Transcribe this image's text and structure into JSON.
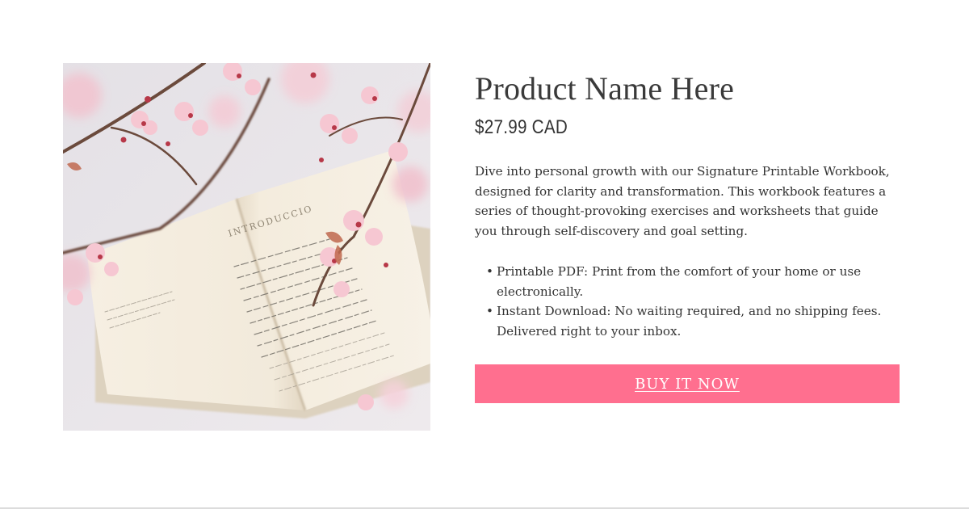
{
  "product": {
    "title": "Product Name Here",
    "price": "$27.99 CAD",
    "description": "Dive into personal growth with our Signature Printable Workbook, designed for clarity and transformation. This workbook features a series of thought-provoking exercises and worksheets that guide you through self-discovery and goal setting.",
    "features": [
      "Printable PDF: Print from the comfort of your home or use electronically.",
      "Instant Download: No waiting required, and no shipping fees. Delivered right to your inbox."
    ],
    "bullet_glyph": "•",
    "buy_button_label": "BUY IT NOW",
    "image_icon": "open-book-cherry-blossom-photo",
    "book_heading": "INTRODUCCIO"
  },
  "colors": {
    "accent": "#ff6f8f",
    "text": "#333333",
    "background": "#ffffff"
  }
}
